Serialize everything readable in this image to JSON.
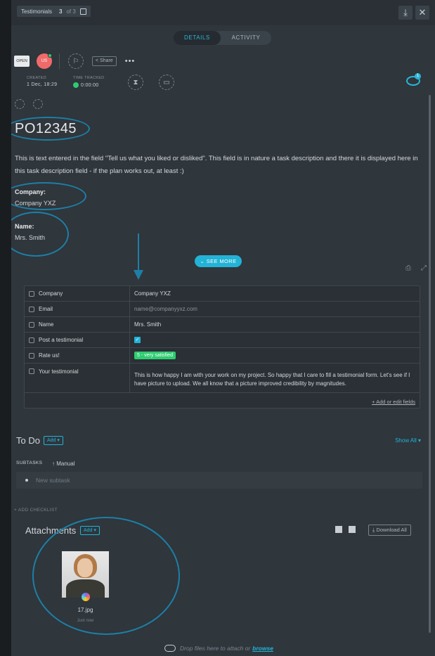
{
  "header": {
    "breadcrumb_list": "Testimonials",
    "breadcrumb_index": "3",
    "breadcrumb_of": "of 3",
    "collapse_icon": "collapse-to-tray-icon",
    "close_icon": "close-icon"
  },
  "tabs": [
    {
      "label": "DETAILS",
      "active": true
    },
    {
      "label": "ACTIVITY",
      "active": false
    }
  ],
  "task": {
    "status": "OPEN",
    "assignee_initials": "US",
    "share_label": "Share",
    "more_label": "•••",
    "created_label": "CREATED",
    "created_value": "1 Dec, 18:29",
    "time_tracked_label": "TIME TRACKED",
    "time_tracked_value": "0:00:00",
    "watchers_count": "1",
    "title": "PO12345",
    "description": "This is text entered in the field \"Tell us what you liked or disliked\". This field is in nature a task description and there it is displayed here in this task description field - if the plan works out, at least :)",
    "company_label": "Company:",
    "company_value": "Company YXZ",
    "name_label": "Name:",
    "name_value": "Mrs. Smith",
    "see_more_label": "SEE MORE"
  },
  "custom_fields": [
    {
      "name": "Company",
      "value": "Company YXZ"
    },
    {
      "name": "Email",
      "value": "name@companyyxz.com"
    },
    {
      "name": "Name",
      "value": "Mrs. Smith"
    },
    {
      "name": "Post a testimonial",
      "value": "✓"
    },
    {
      "name": "Rate us!",
      "value": "5 - very satisfied"
    },
    {
      "name": "Your testimonial",
      "value": "This is how happy I am with your work on my project. So happy that I care to fill a testimonial form. Let's see if I have picture to upload. We all know that a picture improved credibility by magnitudes."
    }
  ],
  "add_edit_fields_label": "+ Add or edit fields",
  "todo": {
    "title": "To Do",
    "add_label": "Add ▾",
    "show_all_label": "Show All ▾",
    "subtasks_label": "SUBTASKS",
    "sort_label": "↑ Manual",
    "new_subtask_placeholder": "New subtask",
    "add_checklist_label": "+ ADD CHECKLIST"
  },
  "attachments": {
    "title": "Attachments",
    "add_label": "Add ▾",
    "download_all_label": "⤓ Download All",
    "files": [
      {
        "name": "17.jpg",
        "time": "Just now"
      }
    ],
    "drop_text": "Drop files here to attach or",
    "browse_label": "browse"
  },
  "colors": {
    "accent": "#22b3d6",
    "panel": "#2f363c",
    "annotation": "#1d7fa6",
    "rate_green": "#2ecc71"
  }
}
